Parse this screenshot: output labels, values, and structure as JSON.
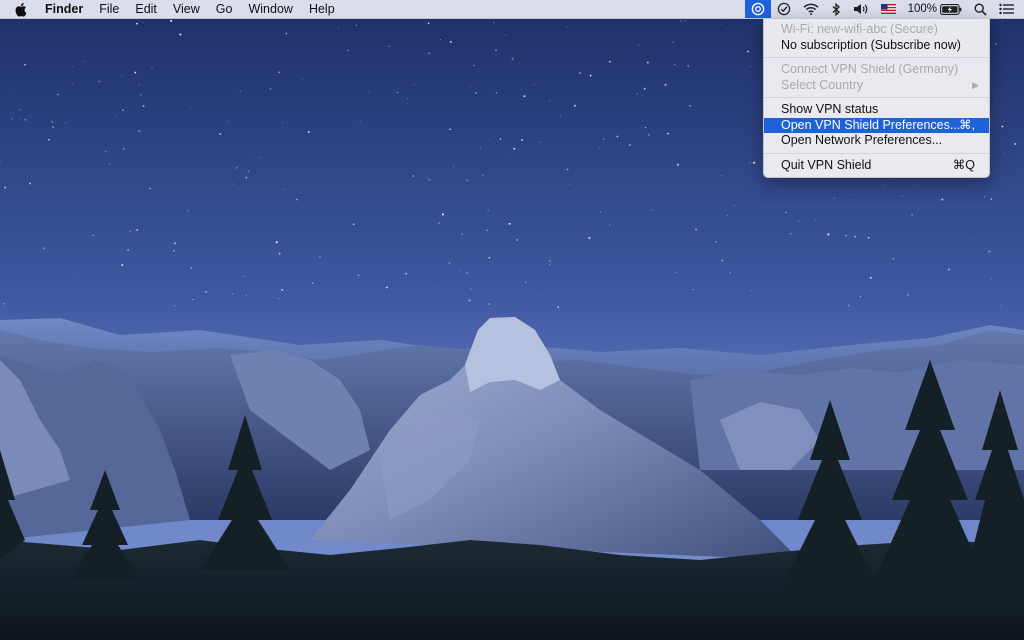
{
  "menubar": {
    "app_name": "Finder",
    "menus": [
      "File",
      "Edit",
      "View",
      "Go",
      "Window",
      "Help"
    ],
    "battery_percent": "100%",
    "status_icons": [
      "vpn-shield-icon",
      "checkmark-circle-icon",
      "wifi-icon",
      "bluetooth-icon",
      "volume-icon",
      "us-flag-icon",
      "battery-icon",
      "spotlight-search-icon",
      "notification-center-icon"
    ]
  },
  "vpn_menu": {
    "wifi_status": "Wi-Fi: new-wifi-abc (Secure)",
    "subscription": "No subscription (Subscribe now)",
    "connect": "Connect VPN Shield (Germany)",
    "select_country": "Select Country",
    "show_status": "Show VPN status",
    "open_prefs": "Open VPN Shield Preferences...",
    "open_prefs_shortcut": "⌘,",
    "open_network_prefs": "Open Network Preferences...",
    "quit": "Quit VPN Shield",
    "quit_shortcut": "⌘Q"
  },
  "colors": {
    "accent": "#1d62d8",
    "sky_top": "#1d2f66",
    "sky_bottom": "#6a83c8"
  }
}
